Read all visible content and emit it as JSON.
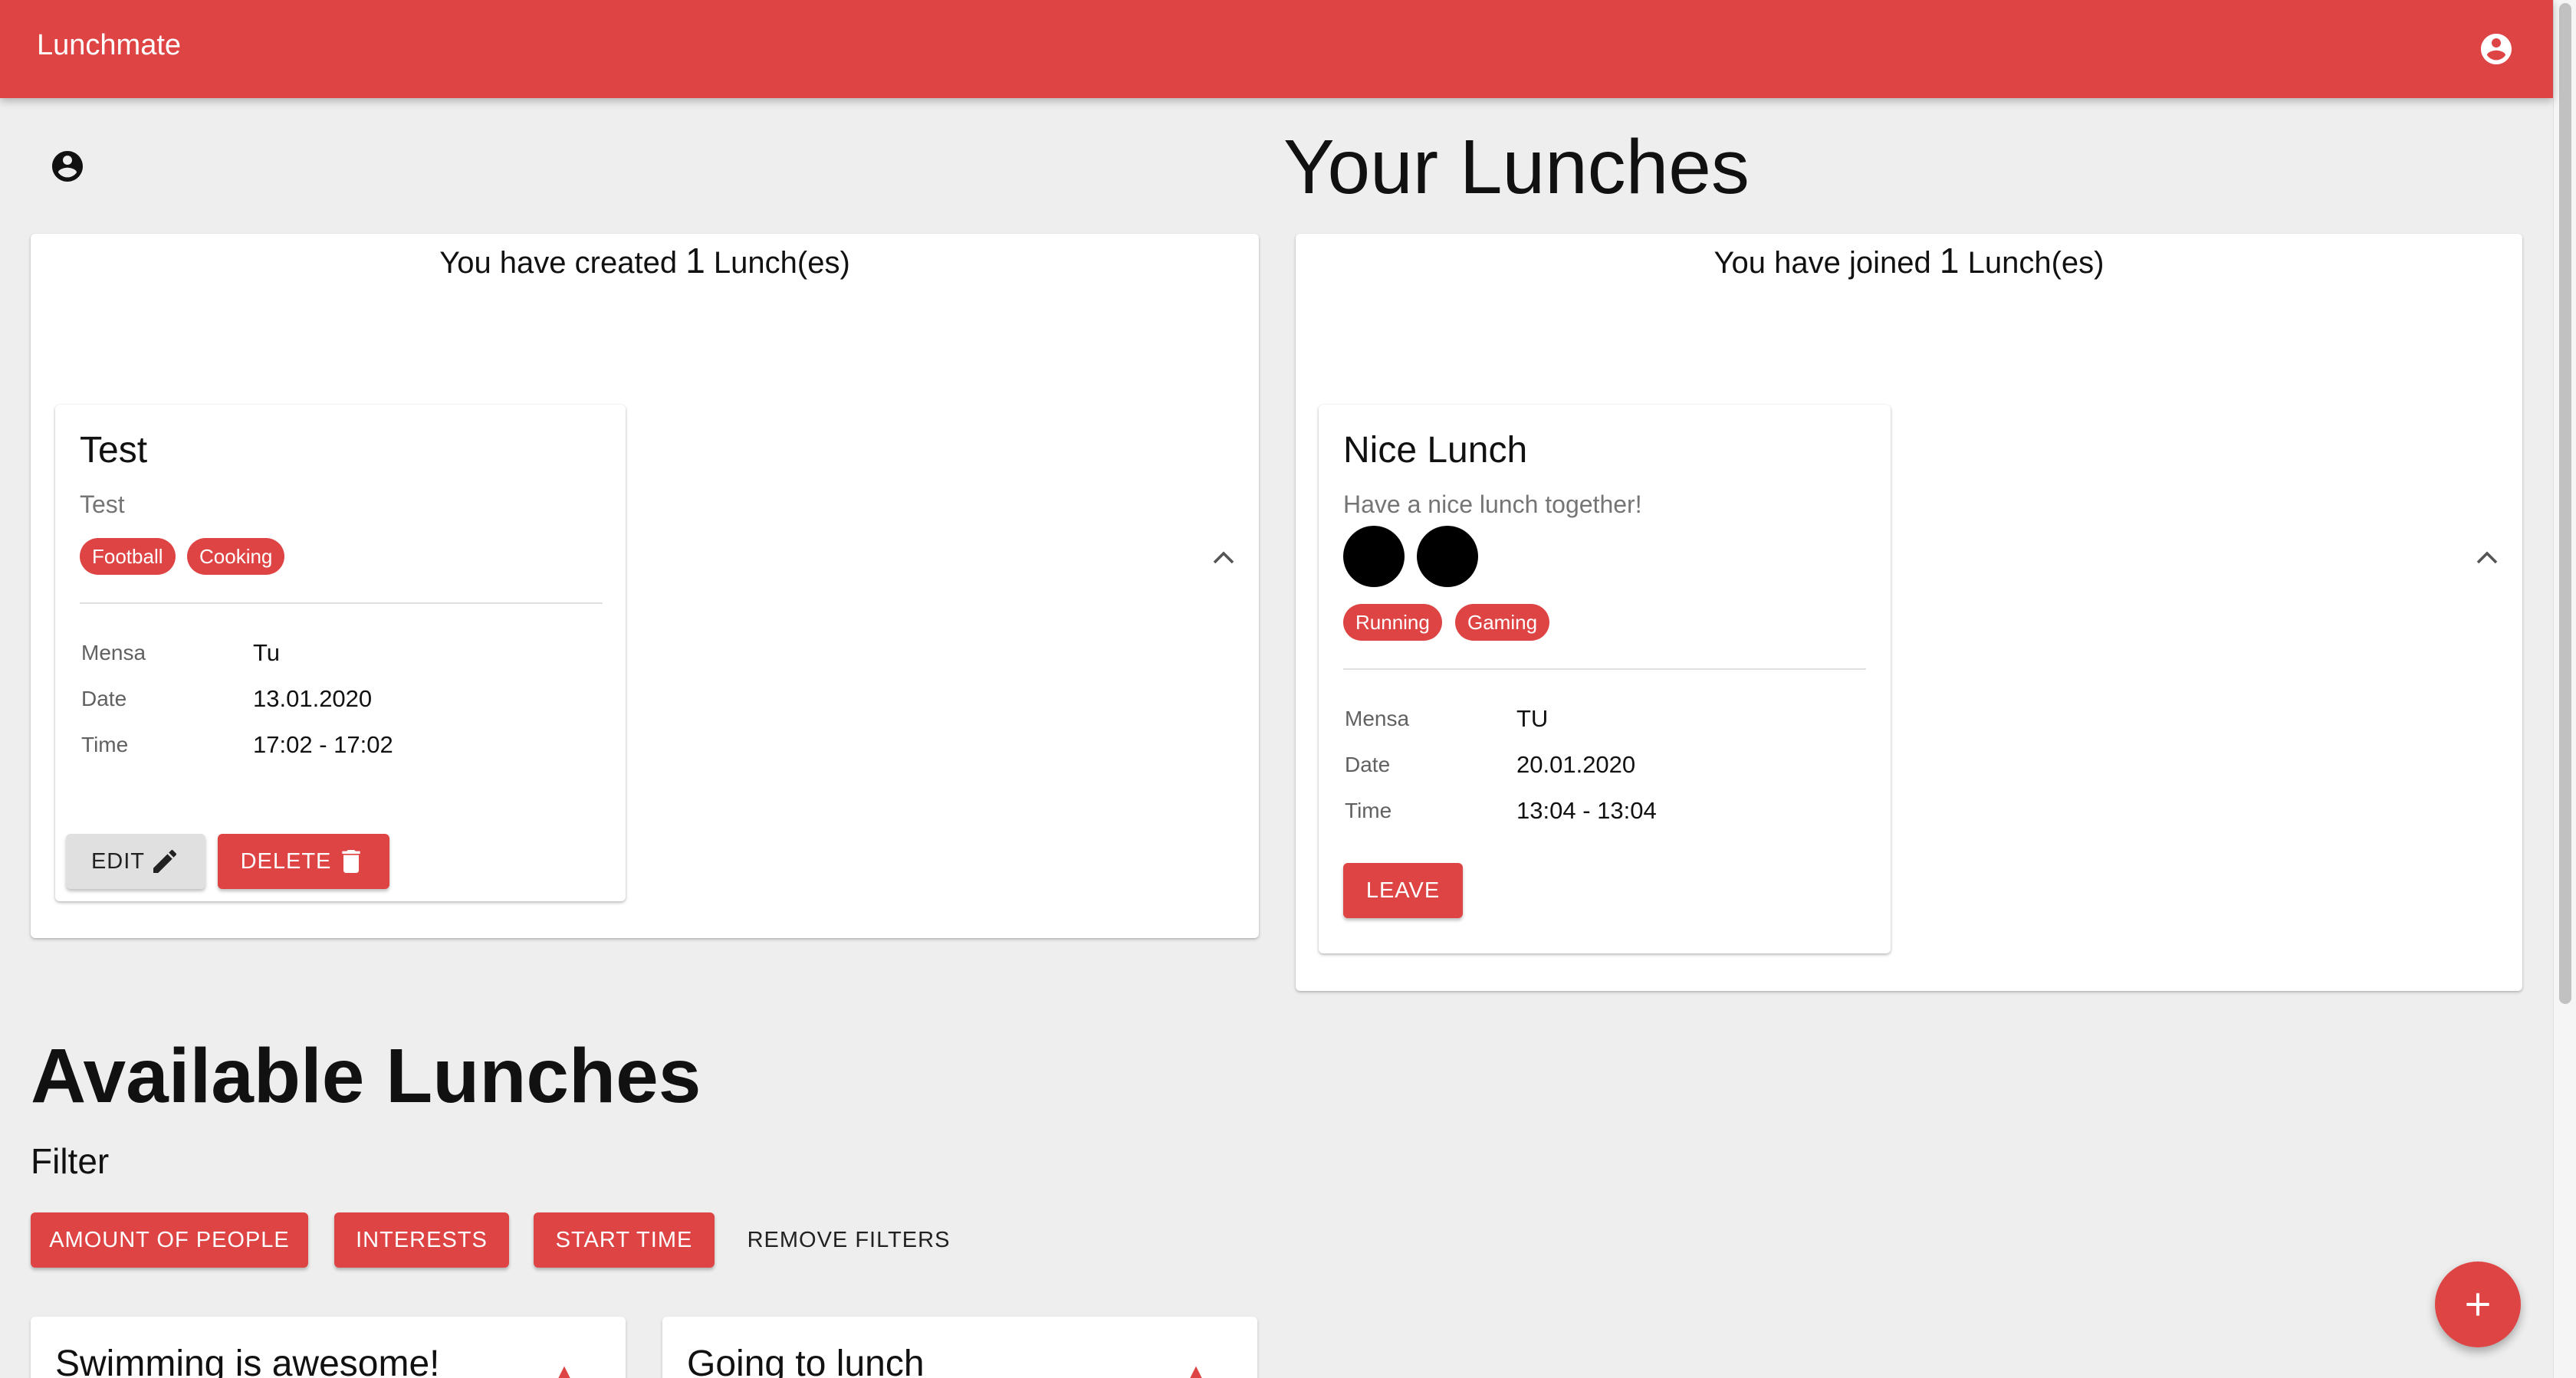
{
  "app": {
    "title": "Lunchmate"
  },
  "your_lunches": {
    "title": "Your Lunches",
    "created": {
      "prefix": "You have created",
      "count": "1",
      "suffix": "Lunch(es)",
      "card": {
        "title": "Test",
        "description": "Test",
        "tags": [
          "Football",
          "Cooking"
        ],
        "details": [
          {
            "label": "Mensa",
            "value": "Tu"
          },
          {
            "label": "Date",
            "value": "13.01.2020"
          },
          {
            "label": "Time",
            "value": "17:02 - 17:02"
          }
        ],
        "edit_label": "EDIT",
        "delete_label": "DELETE"
      }
    },
    "joined": {
      "prefix": "You have joined",
      "count": "1",
      "suffix": "Lunch(es)",
      "card": {
        "title": "Nice Lunch",
        "description": "Have a nice lunch together!",
        "participants": 2,
        "tags": [
          "Running",
          "Gaming"
        ],
        "details": [
          {
            "label": "Mensa",
            "value": "TU"
          },
          {
            "label": "Date",
            "value": "20.01.2020"
          },
          {
            "label": "Time",
            "value": "13:04 - 13:04"
          }
        ],
        "leave_label": "LEAVE"
      }
    }
  },
  "available": {
    "title": "Available Lunches",
    "filter": {
      "label": "Filter",
      "buttons": [
        "AMOUNT OF PEOPLE",
        "INTERESTS",
        "START TIME"
      ],
      "remove_label": "REMOVE FILTERS"
    },
    "cards": [
      {
        "title": "Swimming is awesome!"
      },
      {
        "title": "Going to lunch"
      }
    ]
  },
  "colors": {
    "primary": "#df4444",
    "background": "#eeeeee"
  },
  "icons": {
    "account": "account-circle-icon",
    "add": "add-icon",
    "edit": "pencil-icon",
    "delete": "trash-icon",
    "collapse": "chevron-up-icon"
  }
}
